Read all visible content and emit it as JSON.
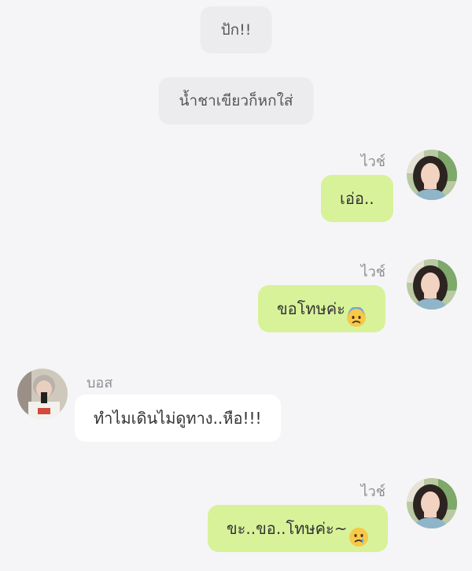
{
  "narrations": [
    {
      "text": "ปัก!!"
    },
    {
      "text": "น้ำชาเขียวก็หกใส่"
    }
  ],
  "messages": [
    {
      "sender": "ไวช์",
      "text": "เอ่อ..",
      "emoji": ""
    },
    {
      "sender": "ไวช์",
      "text": "ขอโทษค่ะ",
      "emoji": "anxious-face-icon"
    },
    {
      "sender": "บอส",
      "text": "ทำไมเดินไม่ดูทาง..หือ!!!",
      "emoji": ""
    },
    {
      "sender": "ไวช์",
      "text": "ขะ..ขอ..โทษค่ะ~",
      "emoji": "crying-face-icon"
    }
  ],
  "colors": {
    "background": "#f5f5f7",
    "narration_bubble": "#ececee",
    "my_bubble": "#d8f29a",
    "other_bubble": "#ffffff",
    "sender_name": "#8e8e93"
  }
}
